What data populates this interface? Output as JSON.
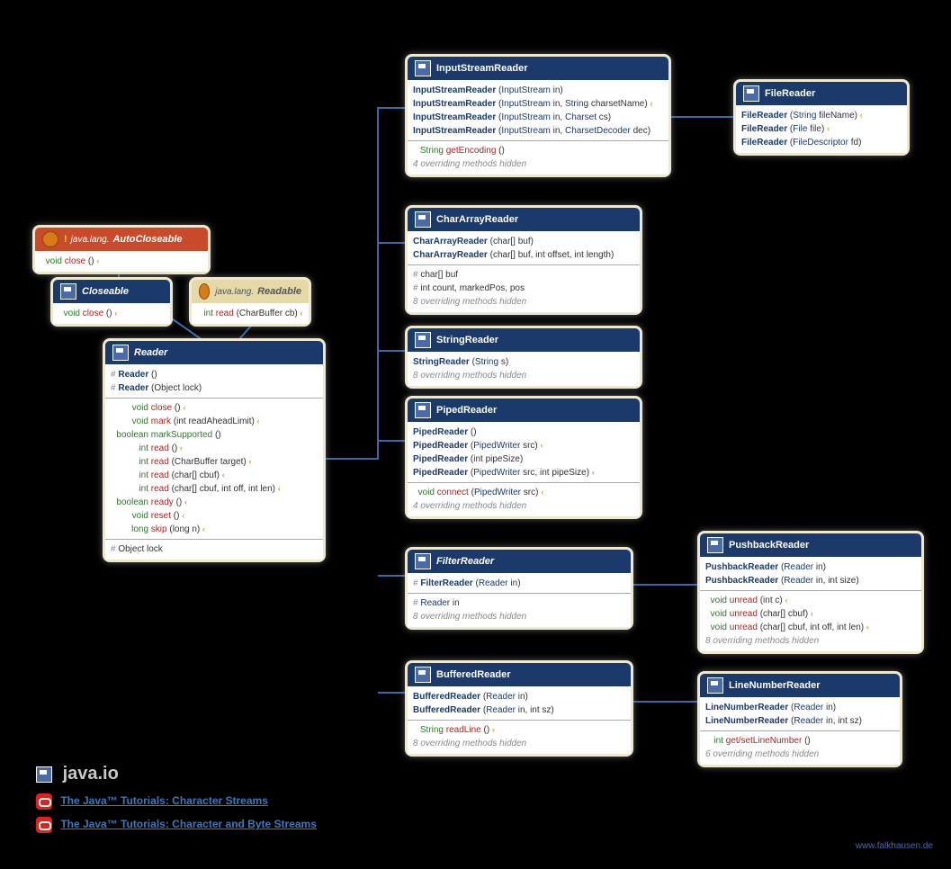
{
  "package": "java.io",
  "links": {
    "l1": "The Java™ Tutorials: Character Streams",
    "l2": "The Java™ Tutorials: Character and Byte Streams"
  },
  "credit": "www.falkhausen.de",
  "classes": {
    "AutoCloseable": {
      "title": "AutoCloseable",
      "pkg": "java.lang.",
      "m1_ret": "void",
      "m1_name": "close",
      "m1_sig": "()",
      "m1_exc": "‹"
    },
    "Closeable": {
      "title": "Closeable",
      "m1_ret": "void",
      "m1_name": "close",
      "m1_sig": "()",
      "m1_exc": "‹"
    },
    "Readable": {
      "title": "Readable",
      "pkg": "java.lang.",
      "m1_ret": "int",
      "m1_name": "read",
      "m1_sig": "(CharBuffer cb)",
      "m1_exc": "‹"
    },
    "Reader": {
      "title": "Reader",
      "c1": "Reader",
      "c1_sig": "()",
      "c2": "Reader",
      "c2_sig": "(Object lock)",
      "m1_ret": "void",
      "m1_name": "close",
      "m1_sig": "()",
      "m1_exc": "‹",
      "m2_ret": "void",
      "m2_name": "mark",
      "m2_sig": "(int readAheadLimit)",
      "m2_exc": "‹",
      "m3_ret": "boolean",
      "m3_name": "markSupported",
      "m3_sig": "()",
      "m4_ret": "int",
      "m4_name": "read",
      "m4_sig": "()",
      "m4_exc": "‹",
      "m5_ret": "int",
      "m5_name": "read",
      "m5_sig": "(CharBuffer target)",
      "m5_exc": "‹",
      "m6_ret": "int",
      "m6_name": "read",
      "m6_sig": "(char[] cbuf)",
      "m6_exc": "‹",
      "m7_ret": "int",
      "m7_name": "read",
      "m7_sig": "(char[] cbuf, int off, int len)",
      "m7_exc": "‹",
      "m8_ret": "boolean",
      "m8_name": "ready",
      "m8_sig": "()",
      "m8_exc": "‹",
      "m9_ret": "void",
      "m9_name": "reset",
      "m9_sig": "()",
      "m9_exc": "‹",
      "m10_ret": "long",
      "m10_name": "skip",
      "m10_sig": "(long n)",
      "m10_exc": "‹",
      "f1": "Object lock"
    },
    "InputStreamReader": {
      "title": "InputStreamReader",
      "c1": "InputStreamReader",
      "c1_sig": "(InputStream in)",
      "c2": "InputStreamReader",
      "c2_sig": "(InputStream in, String charsetName)",
      "c2_exc": "‹",
      "c3": "InputStreamReader",
      "c3_sig": "(InputStream in, Charset cs)",
      "c4": "InputStreamReader",
      "c4_sig": "(InputStream in, CharsetDecoder dec)",
      "m1_ret": "String",
      "m1_name": "getEncoding",
      "m1_sig": "()",
      "hidden": "4 overriding methods hidden"
    },
    "FileReader": {
      "title": "FileReader",
      "c1": "FileReader",
      "c1_sig": "(String fileName)",
      "c1_exc": "‹",
      "c2": "FileReader",
      "c2_sig": "(File file)",
      "c2_exc": "‹",
      "c3": "FileReader",
      "c3_sig": "(FileDescriptor fd)"
    },
    "CharArrayReader": {
      "title": "CharArrayReader",
      "c1": "CharArrayReader",
      "c1_sig": "(char[] buf)",
      "c2": "CharArrayReader",
      "c2_sig": "(char[] buf, int offset, int length)",
      "f1": "char[] buf",
      "f2": "int count, markedPos, pos",
      "hidden": "8 overriding methods hidden"
    },
    "StringReader": {
      "title": "StringReader",
      "c1": "StringReader",
      "c1_sig": "(String s)",
      "hidden": "8 overriding methods hidden"
    },
    "PipedReader": {
      "title": "PipedReader",
      "c1": "PipedReader",
      "c1_sig": "()",
      "c2": "PipedReader",
      "c2_sig": "(PipedWriter src)",
      "c2_exc": "‹",
      "c3": "PipedReader",
      "c3_sig": "(int pipeSize)",
      "c4": "PipedReader",
      "c4_sig": "(PipedWriter src, int pipeSize)",
      "c4_exc": "‹",
      "m1_ret": "void",
      "m1_name": "connect",
      "m1_sig": "(PipedWriter src)",
      "m1_exc": "‹",
      "hidden": "4 overriding methods hidden"
    },
    "FilterReader": {
      "title": "FilterReader",
      "c1": "FilterReader",
      "c1_sig": "(Reader in)",
      "f1": "Reader in",
      "hidden": "8 overriding methods hidden"
    },
    "PushbackReader": {
      "title": "PushbackReader",
      "c1": "PushbackReader",
      "c1_sig": "(Reader in)",
      "c2": "PushbackReader",
      "c2_sig": "(Reader in, int size)",
      "m1_ret": "void",
      "m1_name": "unread",
      "m1_sig": "(int c)",
      "m1_exc": "‹",
      "m2_ret": "void",
      "m2_name": "unread",
      "m2_sig": "(char[] cbuf)",
      "m2_exc": "‹",
      "m3_ret": "void",
      "m3_name": "unread",
      "m3_sig": "(char[] cbuf, int off, int len)",
      "m3_exc": "‹",
      "hidden": "8 overriding methods hidden"
    },
    "BufferedReader": {
      "title": "BufferedReader",
      "c1": "BufferedReader",
      "c1_sig": "(Reader in)",
      "c2": "BufferedReader",
      "c2_sig": "(Reader in, int sz)",
      "m1_ret": "String",
      "m1_name": "readLine",
      "m1_sig": "()",
      "m1_exc": "‹",
      "hidden": "8 overriding methods hidden"
    },
    "LineNumberReader": {
      "title": "LineNumberReader",
      "c1": "LineNumberReader",
      "c1_sig": "(Reader in)",
      "c2": "LineNumberReader",
      "c2_sig": "(Reader in, int sz)",
      "m1_ret": "int",
      "m1_name": "get/setLineNumber",
      "m1_sig": "()",
      "hidden": "6 overriding methods hidden"
    }
  }
}
